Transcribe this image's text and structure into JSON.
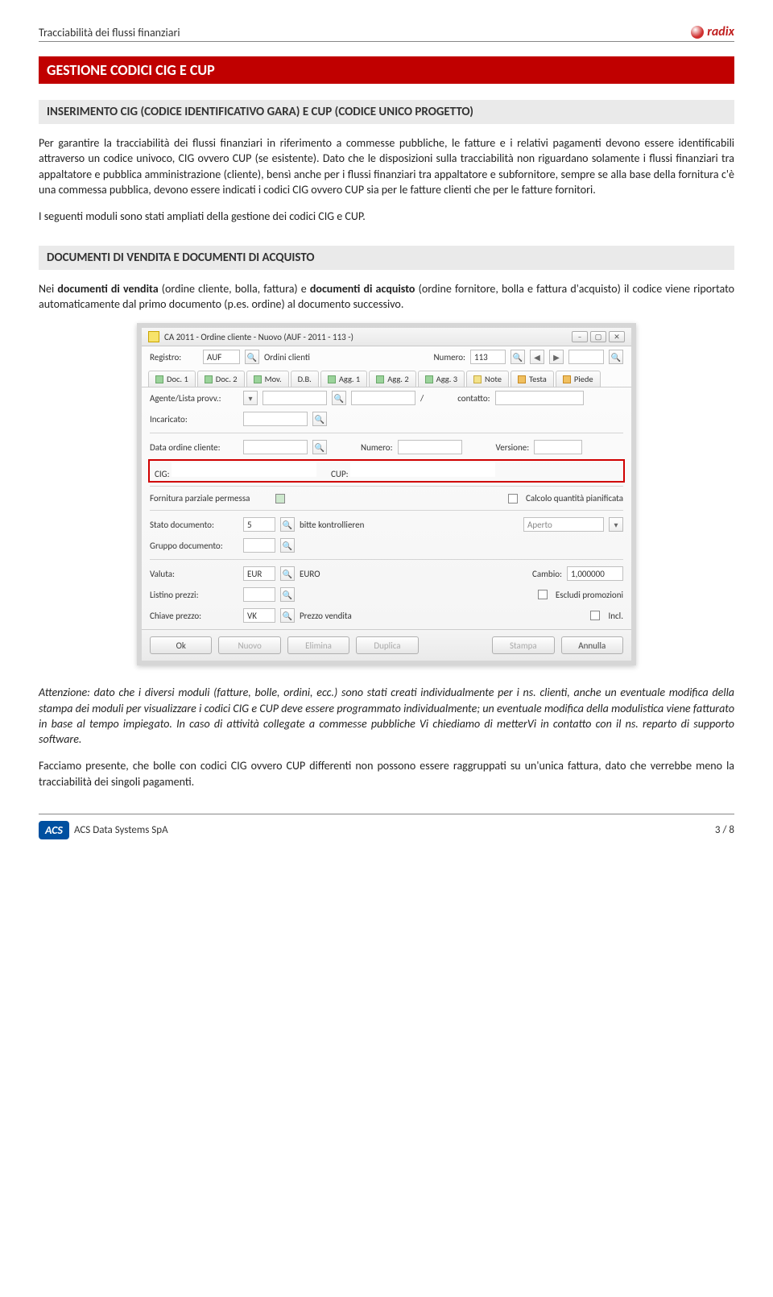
{
  "header": {
    "title": "Tracciabilità dei flussi finanziari",
    "brand": "radix"
  },
  "section_red": "GESTIONE CODICI CIG E CUP",
  "section_sub1": "INSERIMENTO CIG (CODICE IDENTIFICATIVO GARA) E CUP (CODICE UNICO PROGETTO)",
  "para1": "Per garantire la tracciabilità dei flussi finanziari in riferimento a commesse pubbliche, le fatture e i relativi pagamenti devono essere identificabili attraverso un codice univoco, CIG ovvero CUP (se esistente). Dato che le disposizioni sulla tracciabilità non riguardano solamente i flussi finanziari tra appaltatore e pubblica amministrazione (cliente), bensì anche per i flussi finanziari tra appaltatore e subfornitore, sempre se alla base della fornitura c'è una commessa pubblica, devono essere indicati i codici CIG ovvero CUP sia per le fatture clienti che per le fatture fornitori.",
  "para2": "I seguenti moduli sono stati ampliati della gestione dei codici CIG e CUP.",
  "section_sub2": "DOCUMENTI DI VENDITA E DOCUMENTI DI ACQUISTO",
  "para3a": "Nei ",
  "para3b": "documenti di vendita",
  "para3c": " (ordine cliente, bolla, fattura) e ",
  "para3d": "documenti di acquisto",
  "para3e": " (ordine fornitore, bolla e fattura d'acquisto) il codice viene riportato automaticamente dal primo documento (p.es. ordine) al documento successivo.",
  "app": {
    "title": "CA 2011 - Ordine cliente - Nuovo (AUF - 2011 - 113 -)",
    "row_reg": {
      "label": "Registro:",
      "val": "AUF",
      "desc": "Ordini clienti",
      "numlabel": "Numero:",
      "num": "113"
    },
    "tabs": [
      "Doc. 1",
      "Doc. 2",
      "Mov.",
      "D.B.",
      "Agg. 1",
      "Agg. 2",
      "Agg. 3",
      "Note",
      "Testa",
      "Piede"
    ],
    "agente": {
      "label": "Agente/Lista provv.:",
      "contatto_label": "contatto:"
    },
    "incaricato": {
      "label": "Incaricato:"
    },
    "dataord": {
      "label": "Data ordine cliente:",
      "numlabel": "Numero:",
      "verlabel": "Versione:"
    },
    "cig": {
      "label": "CIG:",
      "cup_label": "CUP:"
    },
    "forn": {
      "label": "Fornitura parziale permessa",
      "calc_label": "Calcolo quantità pianificata"
    },
    "stato": {
      "label": "Stato documento:",
      "val": "5",
      "desc": "bitte kontrollieren",
      "aperto": "Aperto"
    },
    "gruppo": {
      "label": "Gruppo documento:"
    },
    "valuta": {
      "label": "Valuta:",
      "val": "EUR",
      "desc": "EURO",
      "cambio_label": "Cambio:",
      "cambio": "1,000000"
    },
    "listino": {
      "label": "Listino prezzi:",
      "escl": "Escludi promozioni"
    },
    "chiave": {
      "label": "Chiave prezzo:",
      "val": "VK",
      "desc": "Prezzo vendita",
      "incl": "Incl."
    },
    "buttons": {
      "ok": "Ok",
      "nuovo": "Nuovo",
      "elimina": "Elimina",
      "duplica": "Duplica",
      "stampa": "Stampa",
      "annulla": "Annulla"
    }
  },
  "attn": "Attenzione: dato che i diversi moduli (fatture, bolle, ordini, ecc.) sono stati creati individualmente per i ns. clienti, anche un eventuale modifica della stampa dei moduli per visualizzare i codici CIG e CUP deve essere programmato individualmente; un eventuale modifica della modulistica viene fatturato in base al tempo impiegato. In caso di  attività collegate a commesse pubbliche Vi chiediamo di metterVi in contatto con il ns. reparto di supporto software.",
  "final": "Facciamo presente, che bolle con codici CIG ovvero CUP differenti non possono essere raggruppati su un'unica fattura, dato che verrebbe meno la tracciabilità dei singoli pagamenti.",
  "footer": {
    "company": "ACS Data Systems SpA",
    "brand": "ACS",
    "page": "3 / 8"
  }
}
